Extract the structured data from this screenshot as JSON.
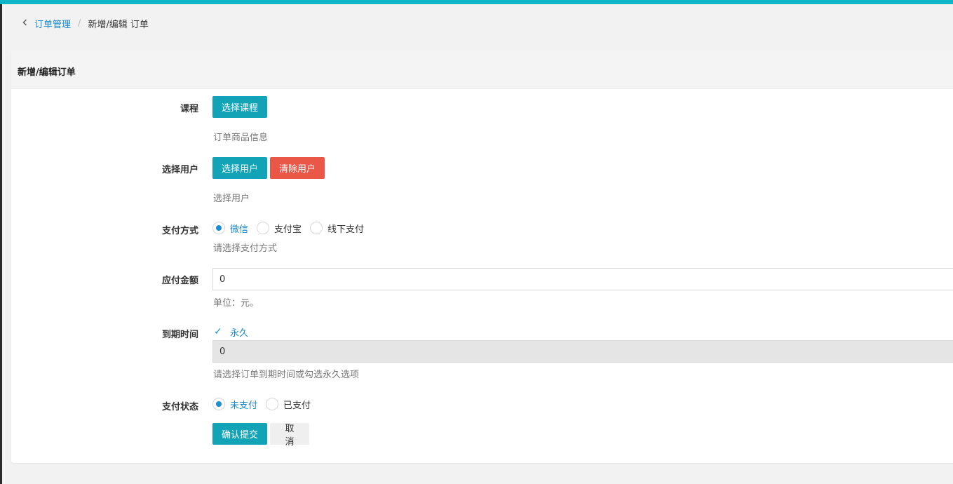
{
  "breadcrumb": {
    "back_icon": "chevron-left-icon",
    "parent": "订单管理",
    "separator": "/",
    "current": "新增/编辑 订单"
  },
  "card": {
    "title": "新增/编辑订单"
  },
  "form": {
    "course": {
      "label": "课程",
      "button": "选择课程",
      "help": "订单商品信息"
    },
    "user": {
      "label": "选择用户",
      "select_button": "选择用户",
      "clear_button": "清除用户",
      "help": "选择用户"
    },
    "payment_method": {
      "label": "支付方式",
      "options": [
        "微信",
        "支付宝",
        "线下支付"
      ],
      "selected": "微信",
      "help": "请选择支付方式"
    },
    "amount": {
      "label": "应付金额",
      "value": "0",
      "help": "单位：元。"
    },
    "expiry": {
      "label": "到期时间",
      "checkbox_label": "永久",
      "checked": true,
      "value": "0",
      "help": "请选择订单到期时间或勾选永久选项"
    },
    "payment_status": {
      "label": "支付状态",
      "options": [
        "未支付",
        "已支付"
      ],
      "selected": "未支付"
    },
    "submit_button": "确认提交",
    "cancel_button": "取 消"
  },
  "colors": {
    "accent": "#13a3b7",
    "danger": "#ea5747",
    "topbar": "#0fb5c9",
    "link": "#1b88c7"
  }
}
